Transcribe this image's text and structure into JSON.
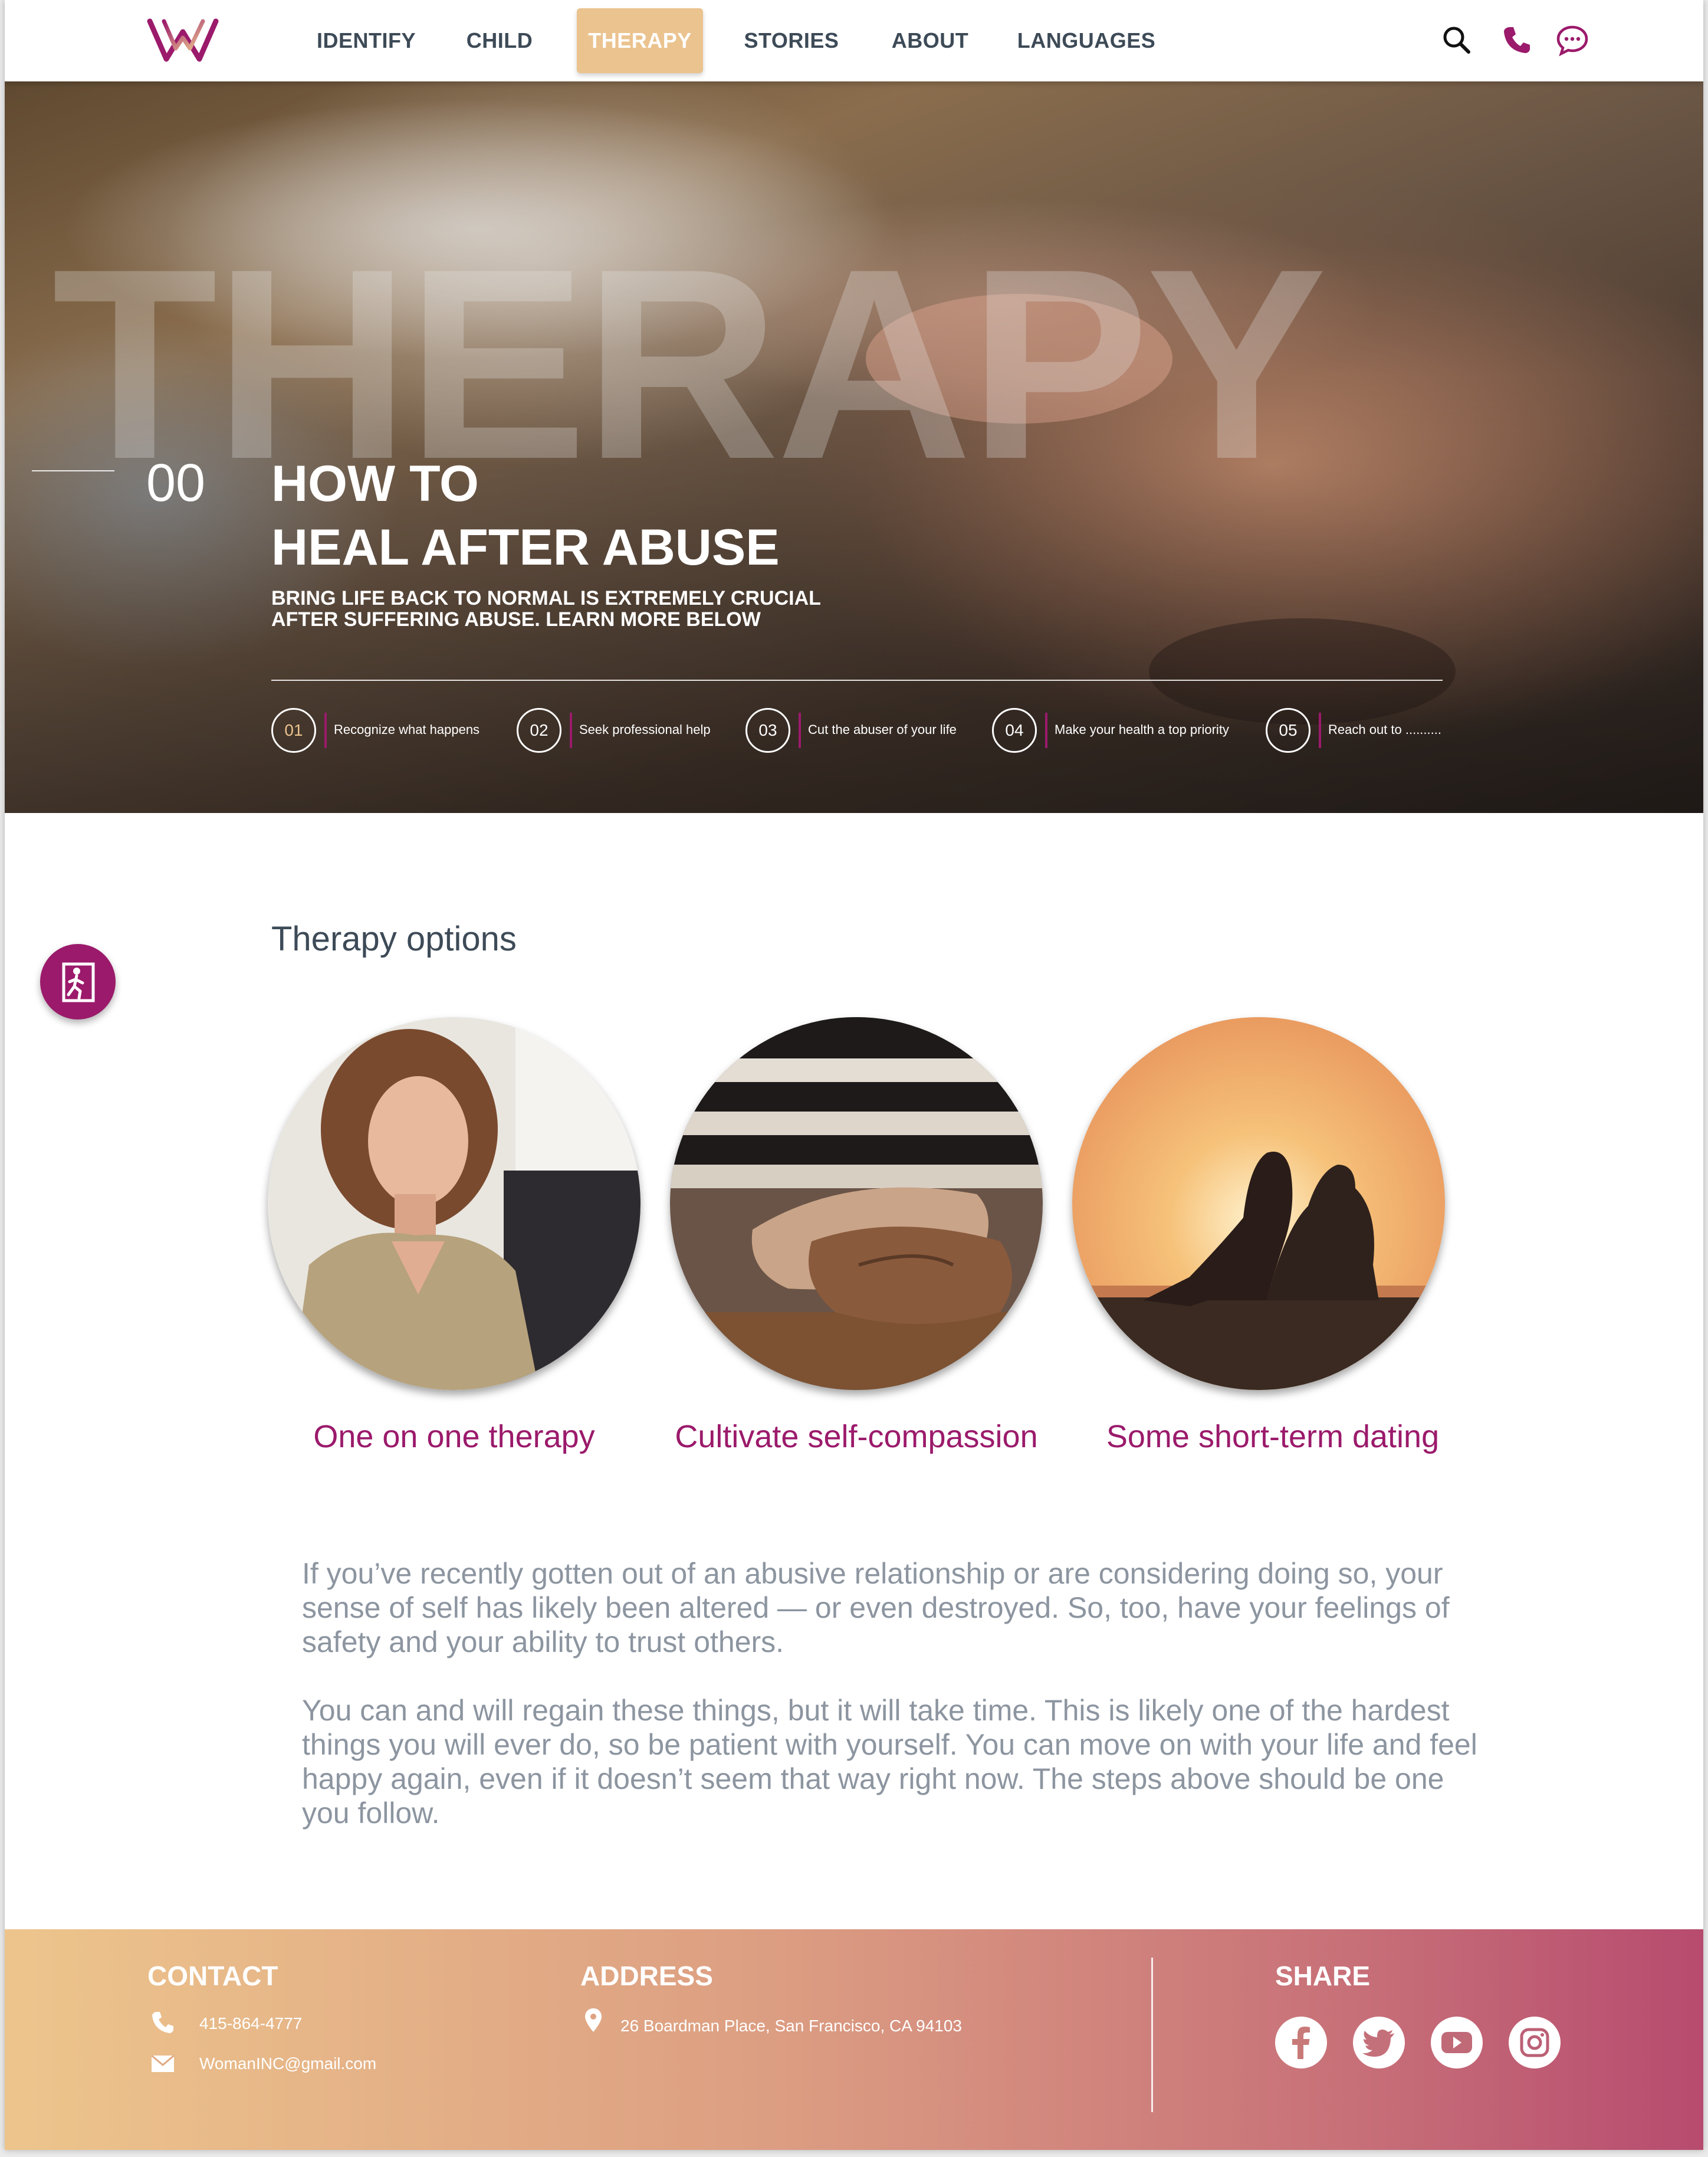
{
  "brand": {
    "logo_letter": "W",
    "primary": "#9b1a6b",
    "accent": "#ebc38f",
    "text": "#3d4a57"
  },
  "nav": {
    "items": [
      {
        "label": "IDENTIFY"
      },
      {
        "label": "CHILD"
      },
      {
        "label": "THERAPY",
        "active": true
      },
      {
        "label": "STORIES"
      },
      {
        "label": "ABOUT"
      },
      {
        "label": "LANGUAGES"
      }
    ],
    "icons": [
      "search-icon",
      "phone-icon",
      "chat-icon"
    ]
  },
  "hero": {
    "watermark": "THERAPY",
    "number": "00",
    "title_line1": "HOW TO",
    "title_line2": "HEAL AFTER ABUSE",
    "subtitle_line1": "BRING LIFE BACK TO NORMAL IS EXTREMELY CRUCIAL",
    "subtitle_line2": "AFTER SUFFERING ABUSE. LEARN MORE BELOW",
    "steps": [
      {
        "num": "01",
        "label": "Recognize what happens",
        "active": true
      },
      {
        "num": "02",
        "label": "Seek professional help"
      },
      {
        "num": "03",
        "label": "Cut the abuser of your life"
      },
      {
        "num": "04",
        "label": "Make your health a top priority"
      },
      {
        "num": "05",
        "label": "Reach out to .........."
      }
    ]
  },
  "exit_button": {
    "icon": "exit-door-icon"
  },
  "options": {
    "title": "Therapy options",
    "items": [
      {
        "label": "One on one therapy",
        "image": "woman-portrait-photo"
      },
      {
        "label": "Cultivate self-compassion",
        "image": "holding-hands-photo"
      },
      {
        "label": "Some short-term dating",
        "image": "couple-sunset-photo"
      }
    ]
  },
  "body": {
    "paragraph1": "If you’ve recently gotten out of an abusive relationship or are considering doing so, your sense of self has likely been altered — or even destroyed. So, too, have your feelings of safety and your ability to trust others.",
    "paragraph2": "You can and will regain these things, but it will take time. This is likely one of the hardest things you will ever do, so be patient with yourself. You can move on with your life and feel happy again, even if it doesn’t seem that way right now. The steps above should be one you follow."
  },
  "footer": {
    "contact_heading": "CONTACT",
    "phone": "415-864-4777",
    "email": "WomanINC@gmail.com",
    "address_heading": "ADDRESS",
    "address": "26 Boardman Place, San Francisco, CA 94103",
    "share_heading": "SHARE",
    "social": [
      "facebook-icon",
      "twitter-icon",
      "youtube-icon",
      "instagram-icon"
    ]
  }
}
